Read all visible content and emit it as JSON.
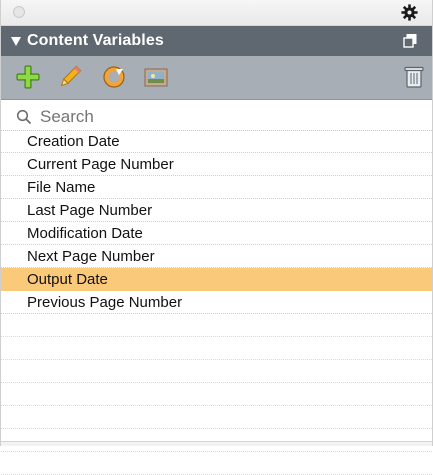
{
  "window": {
    "close_icon": "window-close-dot",
    "settings_icon": "gear-icon"
  },
  "panel": {
    "title": "Content Variables",
    "collapse_icon": "disclosure-triangle-icon",
    "copy_icon": "duplicate-icon"
  },
  "toolbar": {
    "buttons": [
      {
        "name": "add-variable-button",
        "icon": "plus-icon"
      },
      {
        "name": "edit-variable-button",
        "icon": "pencil-icon"
      },
      {
        "name": "refresh-variable-button",
        "icon": "refresh-icon"
      },
      {
        "name": "properties-variable-button",
        "icon": "image-properties-icon"
      }
    ],
    "delete_icon": "trash-icon"
  },
  "search": {
    "placeholder": "Search",
    "value": ""
  },
  "variables": [
    {
      "label": "Creation Date",
      "selected": false
    },
    {
      "label": "Current Page Number",
      "selected": false
    },
    {
      "label": "File Name",
      "selected": false
    },
    {
      "label": "Last Page Number",
      "selected": false
    },
    {
      "label": "Modification Date",
      "selected": false
    },
    {
      "label": "Next Page Number",
      "selected": false
    },
    {
      "label": "Output Date",
      "selected": true
    },
    {
      "label": "Previous Page Number",
      "selected": false
    }
  ],
  "colors": {
    "header": "#5f6770",
    "toolbar": "#a8aeb5",
    "selection": "#fbc97a"
  }
}
